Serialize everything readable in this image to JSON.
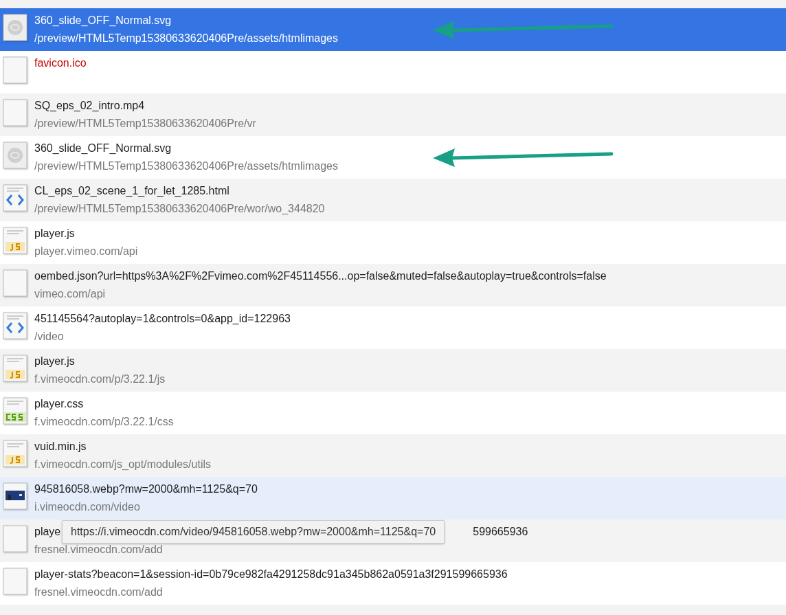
{
  "requests": [
    {
      "name": "360_slide_OFF_Normal.svg",
      "path": "/preview/HTML5Temp15380633620406Pre/assets/htmlimages",
      "kind": "svg",
      "selected": true,
      "hovered": false,
      "failed": false,
      "arrow": true
    },
    {
      "name": "favicon.ico",
      "kind": "blank",
      "selected": false,
      "hovered": false,
      "failed": true,
      "arrow": false
    },
    {
      "name": "SQ_eps_02_intro.mp4",
      "path": "/preview/HTML5Temp15380633620406Pre/vr",
      "kind": "blank",
      "selected": false,
      "hovered": false,
      "failed": false,
      "arrow": false
    },
    {
      "name": "360_slide_OFF_Normal.svg",
      "path": "/preview/HTML5Temp15380633620406Pre/assets/htmlimages",
      "kind": "svg",
      "selected": false,
      "hovered": false,
      "failed": false,
      "arrow": true
    },
    {
      "name": "CL_eps_02_scene_1_for_let_1285.html",
      "path": "/preview/HTML5Temp15380633620406Pre/wor/wo_344820",
      "kind": "html",
      "selected": false,
      "hovered": false,
      "failed": false,
      "arrow": false
    },
    {
      "name": "player.js",
      "path": "player.vimeo.com/api",
      "kind": "js",
      "selected": false,
      "hovered": false,
      "failed": false,
      "arrow": false
    },
    {
      "name": "oembed.json?url=https%3A%2F%2Fvimeo.com%2F45114556...op=false&muted=false&autoplay=true&controls=false",
      "path": "vimeo.com/api",
      "kind": "blank",
      "selected": false,
      "hovered": false,
      "failed": false,
      "arrow": false
    },
    {
      "name": "451145564?autoplay=1&controls=0&app_id=122963",
      "path": "/video",
      "kind": "html",
      "selected": false,
      "hovered": false,
      "failed": false,
      "arrow": false
    },
    {
      "name": "player.js",
      "path": "f.vimeocdn.com/p/3.22.1/js",
      "kind": "js",
      "selected": false,
      "hovered": false,
      "failed": false,
      "arrow": false
    },
    {
      "name": "player.css",
      "path": "f.vimeocdn.com/p/3.22.1/css",
      "kind": "css",
      "selected": false,
      "hovered": false,
      "failed": false,
      "arrow": false
    },
    {
      "name": "vuid.min.js",
      "path": "f.vimeocdn.com/js_opt/modules/utils",
      "kind": "js",
      "selected": false,
      "hovered": false,
      "failed": false,
      "arrow": false
    },
    {
      "name": "945816058.webp?mw=2000&mh=1125&q=70",
      "path": "i.vimeocdn.com/video",
      "kind": "image",
      "selected": false,
      "hovered": true,
      "failed": false,
      "arrow": false,
      "tooltip": "https://i.vimeocdn.com/video/945816058.webp?mw=2000&mh=1125&q=70"
    },
    {
      "name_parts": [
        "playe",
        "599665936"
      ],
      "path": "fresnel.vimeocdn.com/add",
      "kind": "blank",
      "selected": false,
      "hovered": false,
      "failed": false,
      "arrow": false
    },
    {
      "name": "player-stats?beacon=1&session-id=0b79ce982fa4291258dc91a345b862a0591a3f291599665936",
      "path": "fresnel.vimeocdn.com/add",
      "kind": "blank",
      "selected": false,
      "hovered": false,
      "failed": false,
      "arrow": false
    }
  ]
}
